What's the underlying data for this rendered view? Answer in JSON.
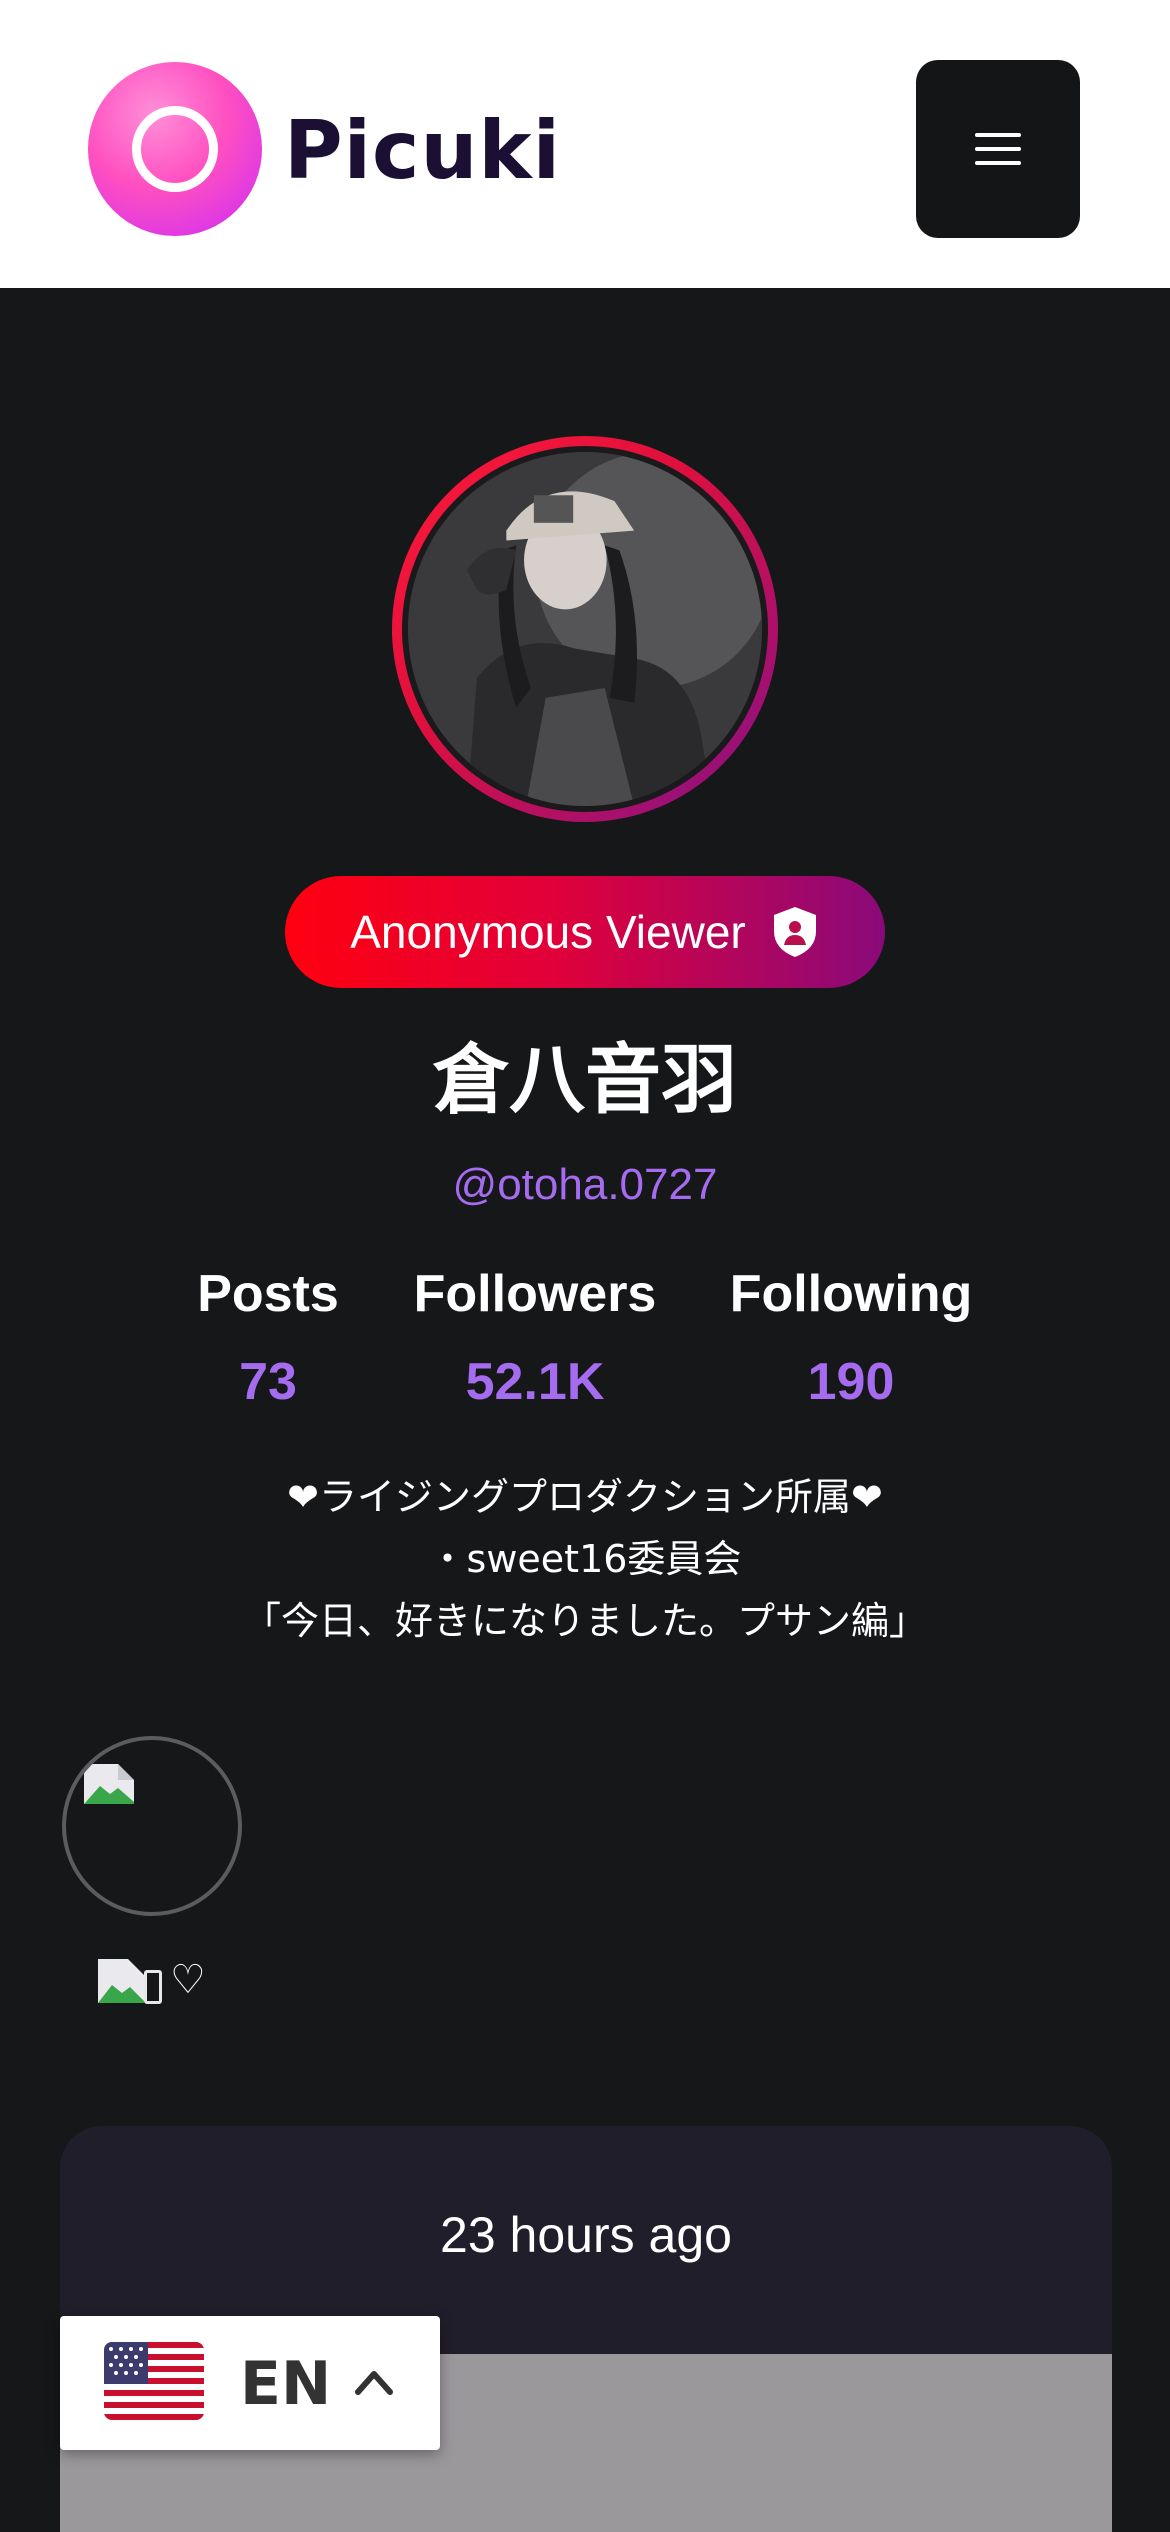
{
  "header": {
    "brand": "Picuki",
    "menu_icon": "hamburger-menu-icon"
  },
  "profile": {
    "badge_label": "Anonymous Viewer",
    "badge_icon": "shield-icon",
    "display_name": "倉八音羽",
    "handle": "@otoha.0727",
    "stats": {
      "posts_label": "Posts",
      "posts_value": "73",
      "followers_label": "Followers",
      "followers_value": "52.1K",
      "following_label": "Following",
      "following_value": "190"
    },
    "bio": [
      "❤ライジングプロダクション所属❤",
      "・sweet16委員会",
      "「今日、好きになりました。プサン編」"
    ]
  },
  "highlights": [
    {
      "label_suffix": "♡",
      "icon": "broken-image-icon"
    }
  ],
  "post": {
    "time": "23 hours ago"
  },
  "language": {
    "code": "EN",
    "flag": "us-flag-icon",
    "chevron": "chevron-up-icon"
  },
  "colors": {
    "page_bg": "#161719",
    "accent_purple": "#a56cf0",
    "badge_start": "#ff0010",
    "badge_end": "#8a0a7a",
    "card_bg": "#211e2b"
  }
}
